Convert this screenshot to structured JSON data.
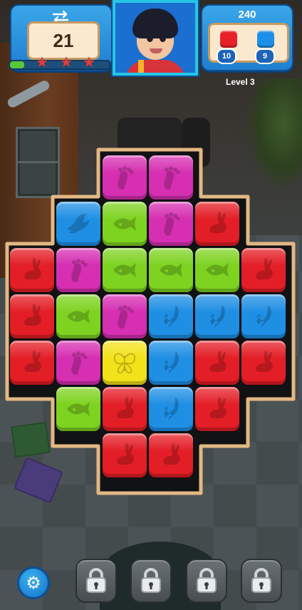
{
  "hud": {
    "moves_left": "21",
    "swap_icon": "swap-arrows-icon",
    "stars_earned": 0,
    "stars_total": 3,
    "progress_fraction": 0.14,
    "score": "240",
    "level_label": "Level 3",
    "goals": [
      {
        "color_name": "red",
        "color": "#e8202a",
        "count": "10"
      },
      {
        "color_name": "blue",
        "color": "#1e8fe6",
        "count": "9"
      }
    ]
  },
  "palette": {
    "red": "#e41e26",
    "blue": "#1f8fe4",
    "green": "#7ed321",
    "pink": "#d62fb2",
    "yellow": "#f2e21a",
    "frame": "#e2b883",
    "frame_dark": "#111214"
  },
  "board": {
    "tiles": [
      {
        "row": 0,
        "col": 2,
        "color": "pink",
        "icon": "footprint"
      },
      {
        "row": 0,
        "col": 3,
        "color": "pink",
        "icon": "footprint"
      },
      {
        "row": 1,
        "col": 1,
        "color": "blue",
        "icon": "bird"
      },
      {
        "row": 1,
        "col": 2,
        "color": "green",
        "icon": "fish"
      },
      {
        "row": 1,
        "col": 3,
        "color": "pink",
        "icon": "footprint"
      },
      {
        "row": 1,
        "col": 4,
        "color": "red",
        "icon": "rabbit"
      },
      {
        "row": 2,
        "col": 0,
        "color": "red",
        "icon": "rabbit"
      },
      {
        "row": 2,
        "col": 1,
        "color": "pink",
        "icon": "footprint"
      },
      {
        "row": 2,
        "col": 2,
        "color": "green",
        "icon": "fish"
      },
      {
        "row": 2,
        "col": 3,
        "color": "green",
        "icon": "fish"
      },
      {
        "row": 2,
        "col": 4,
        "color": "green",
        "icon": "fish"
      },
      {
        "row": 2,
        "col": 5,
        "color": "red",
        "icon": "rabbit"
      },
      {
        "row": 3,
        "col": 0,
        "color": "red",
        "icon": "rabbit"
      },
      {
        "row": 3,
        "col": 1,
        "color": "green",
        "icon": "fish"
      },
      {
        "row": 3,
        "col": 2,
        "color": "pink",
        "icon": "footprint"
      },
      {
        "row": 3,
        "col": 3,
        "color": "blue",
        "icon": "rocket"
      },
      {
        "row": 3,
        "col": 4,
        "color": "blue",
        "icon": "rocket"
      },
      {
        "row": 3,
        "col": 5,
        "color": "blue",
        "icon": "rocket"
      },
      {
        "row": 4,
        "col": 0,
        "color": "red",
        "icon": "rabbit"
      },
      {
        "row": 4,
        "col": 1,
        "color": "pink",
        "icon": "footprint"
      },
      {
        "row": 4,
        "col": 2,
        "color": "yellow",
        "icon": "butterfly"
      },
      {
        "row": 4,
        "col": 3,
        "color": "blue",
        "icon": "rocket"
      },
      {
        "row": 4,
        "col": 4,
        "color": "red",
        "icon": "rabbit"
      },
      {
        "row": 4,
        "col": 5,
        "color": "red",
        "icon": "rabbit"
      },
      {
        "row": 5,
        "col": 1,
        "color": "green",
        "icon": "fish"
      },
      {
        "row": 5,
        "col": 2,
        "color": "red",
        "icon": "rabbit"
      },
      {
        "row": 5,
        "col": 3,
        "color": "blue",
        "icon": "rocket"
      },
      {
        "row": 5,
        "col": 4,
        "color": "red",
        "icon": "rabbit"
      },
      {
        "row": 6,
        "col": 2,
        "color": "red",
        "icon": "rabbit"
      },
      {
        "row": 6,
        "col": 3,
        "color": "red",
        "icon": "rabbit"
      }
    ]
  },
  "bottom_bar": {
    "settings_icon": "gear-icon",
    "boosters": [
      {
        "icon": "padlock-icon",
        "locked": true
      },
      {
        "icon": "padlock-icon",
        "locked": true
      },
      {
        "icon": "padlock-icon",
        "locked": true
      },
      {
        "icon": "padlock-icon",
        "locked": true
      }
    ]
  }
}
